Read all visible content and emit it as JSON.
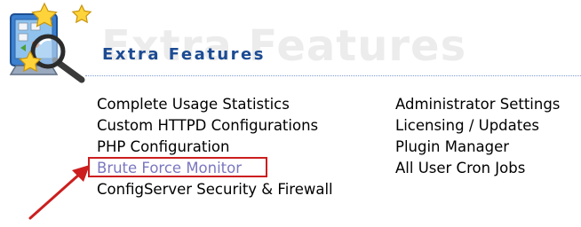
{
  "header": {
    "title": "Extra Features",
    "watermark": "Extra Features"
  },
  "left_column": [
    {
      "label": "Complete Usage Statistics"
    },
    {
      "label": "Custom HTTPD Configurations"
    },
    {
      "label": "PHP Configuration"
    },
    {
      "label": "Brute Force Monitor",
      "visited": true,
      "highlighted": true
    },
    {
      "label": "ConfigServer Security & Firewall"
    }
  ],
  "right_column": [
    {
      "label": "Administrator Settings"
    },
    {
      "label": "Licensing / Updates"
    },
    {
      "label": "Plugin Manager"
    },
    {
      "label": "All User Cron Jobs"
    }
  ],
  "annotation": {
    "highlight_color": "#cc1e1e",
    "arrow_color": "#cc1e1e"
  },
  "icons": [
    "extra-features-icon",
    "star-icon",
    "magnifier-icon"
  ],
  "colors": {
    "title": "#1c4b93",
    "link": "#000000",
    "visited_link": "#7b77c0"
  }
}
